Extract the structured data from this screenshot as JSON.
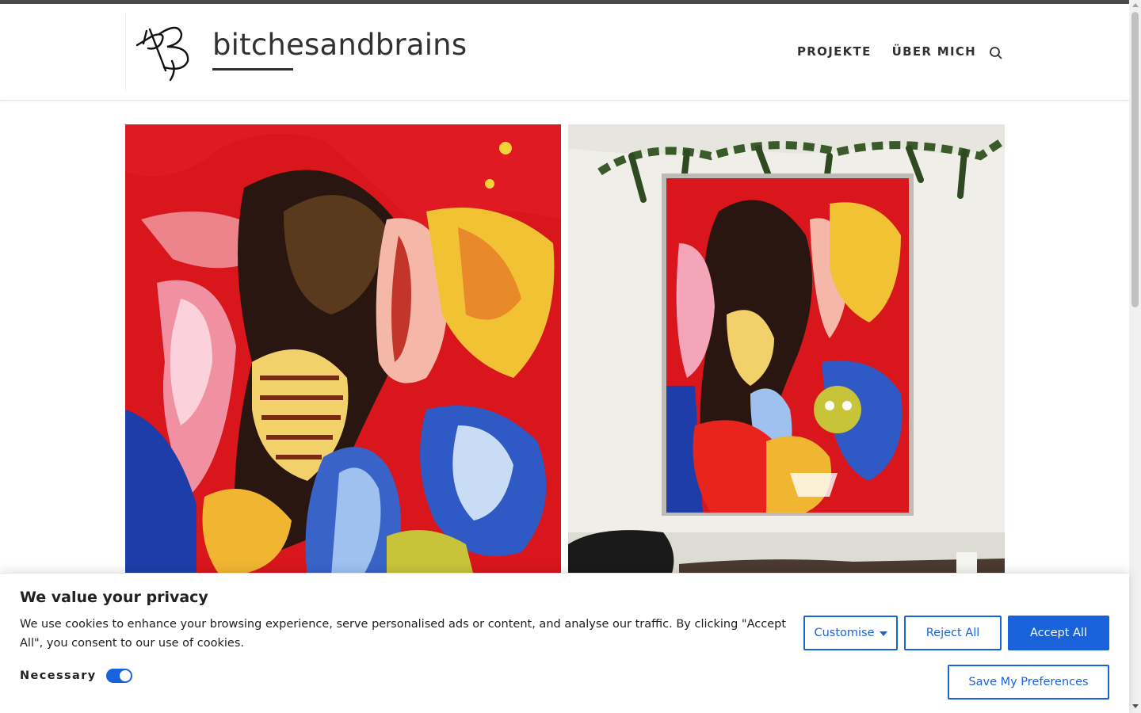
{
  "site": {
    "title": "bitchesandbrains",
    "logo_initials": "BB"
  },
  "nav": {
    "items": [
      "PROJEKTE",
      "ÜBER MICH"
    ],
    "search_icon": "search-icon"
  },
  "gallery": {
    "images": [
      {
        "name": "painting-closeup"
      },
      {
        "name": "painting-on-wall"
      }
    ]
  },
  "cookie_banner": {
    "title": "We value your privacy",
    "text": "We use cookies to enhance your browsing experience, serve personalised ads or content, and analyse our traffic. By clicking \"Accept All\", you consent to our use of cookies.",
    "necessary_label": "Necessary",
    "necessary_enabled": true,
    "customise_label": "Customise",
    "reject_label": "Reject All",
    "accept_label": "Accept All",
    "save_label": "Save My Preferences"
  },
  "colors": {
    "accent": "#1863dc",
    "text": "#313131"
  }
}
